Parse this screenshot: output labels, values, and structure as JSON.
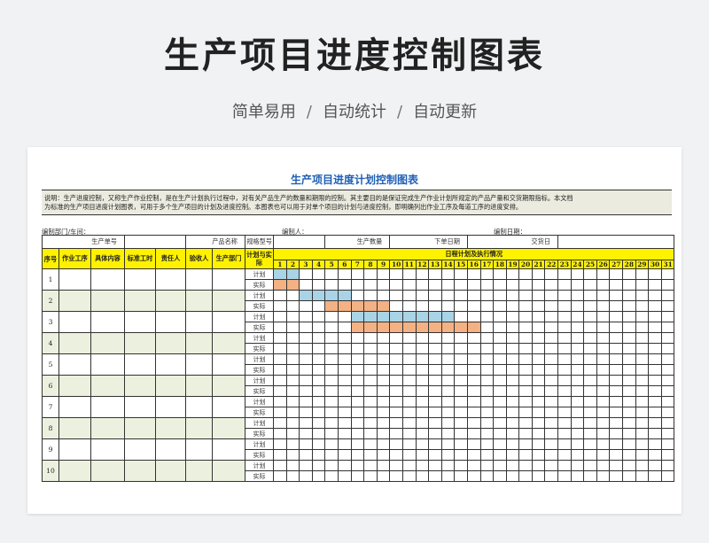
{
  "banner": {
    "title": "生产项目进度控制图表",
    "tags": [
      "简单易用",
      "自动统计",
      "自动更新"
    ],
    "separator": "/"
  },
  "sheet": {
    "title": "生产项目进度计划控制图表",
    "description_line1": "说明：生产进度控制，又称生产作业控制，是在生产计划执行过程中，对有关产品生产的数量和期限的控制。其主要目的是保证完成生产作业计划所规定的产品产量和交货期限指标。本文档",
    "description_line2": "为标准的生产项目进度计划图表，可用于多个生产项目的计划及进度控制。本图表也可以用于对单个项目的计划与进度控制，即明确列出作业工序及每道工序的进度安排。",
    "info": {
      "dept": "编制部门/车间：",
      "editor": "编制人：",
      "date": "编制日期："
    },
    "fields": {
      "order_no": "生产单号",
      "product_name": "产品名称",
      "spec": "规格型号",
      "qty": "生产数量",
      "order_date": "下单日期",
      "delivery_date": "交货日"
    },
    "headers": {
      "seq": "序号",
      "process": "作业工序",
      "content": "具体内容",
      "std_time": "标准工时",
      "owner": "责任人",
      "checker": "验收人",
      "dept": "生产部门",
      "plan_actual": "计划与实际",
      "schedule": "日程计划及执行情况"
    },
    "days": [
      1,
      2,
      3,
      4,
      5,
      6,
      7,
      8,
      9,
      10,
      11,
      12,
      13,
      14,
      15,
      16,
      17,
      18,
      19,
      20,
      21,
      22,
      23,
      24,
      25,
      26,
      27,
      28,
      29,
      30,
      31
    ],
    "plan_label": "计划",
    "actual_label": "实际",
    "rows": [
      {
        "seq": "1",
        "plan": [
          1,
          2
        ],
        "actual": [
          1,
          2
        ]
      },
      {
        "seq": "2",
        "plan": [
          3,
          6
        ],
        "actual": [
          5,
          9
        ]
      },
      {
        "seq": "3",
        "plan": [
          7,
          14
        ],
        "actual": [
          7,
          16
        ]
      },
      {
        "seq": "4",
        "plan": null,
        "actual": null
      },
      {
        "seq": "5",
        "plan": null,
        "actual": null
      },
      {
        "seq": "6",
        "plan": null,
        "actual": null
      },
      {
        "seq": "7",
        "plan": null,
        "actual": null
      },
      {
        "seq": "8",
        "plan": null,
        "actual": null
      },
      {
        "seq": "9",
        "plan": null,
        "actual": null
      },
      {
        "seq": "10",
        "plan": null,
        "actual": null
      }
    ],
    "colors": {
      "plan": "#a9d3e6",
      "actual": "#f4b183",
      "header_yellow": "#fff200",
      "row_alt": "#ebf1de",
      "title_blue": "#1f5fb5"
    }
  }
}
